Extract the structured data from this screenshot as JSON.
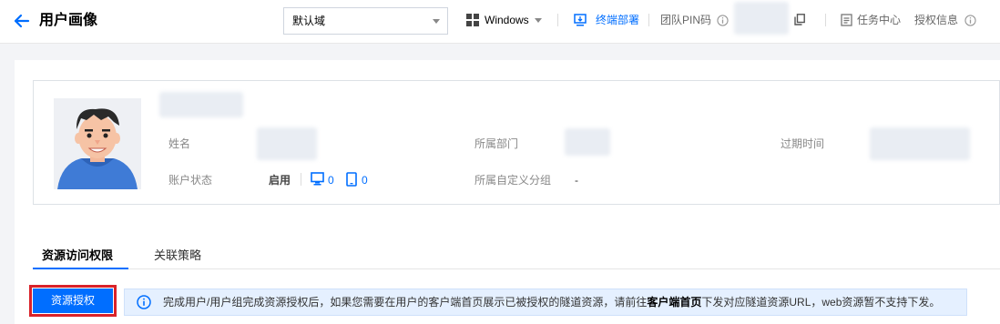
{
  "header": {
    "title": "用户画像",
    "domain_select": "默认域",
    "os_label": "Windows",
    "terminal_deploy": "终端部署",
    "team_pin": "团队PIN码",
    "task_center": "任务中心",
    "license_info": "授权信息"
  },
  "profile": {
    "name_label": "姓名",
    "dept_label": "所属部门",
    "expire_label": "过期时间",
    "status_label": "账户状态",
    "status_value": "启用",
    "pc_count": "0",
    "mobile_count": "0",
    "custom_group_label": "所属自定义分组",
    "custom_group_value": "-"
  },
  "tabs": [
    {
      "label": "资源访问权限",
      "active": true
    },
    {
      "label": "关联策略",
      "active": false
    }
  ],
  "actions": {
    "grant_button": "资源授权"
  },
  "notice": {
    "part1": "完成用户/用户组完成资源授权后，如果您需要在用户的客户端首页展示已被授权的隧道资源，请前往",
    "bold": "客户端首页",
    "part2": "下发对应隧道资源URL，web资源暂不支持下发。"
  },
  "colors": {
    "accent": "#006eff",
    "highlight": "#d9222a",
    "notice_bg": "#e5f0ff"
  }
}
